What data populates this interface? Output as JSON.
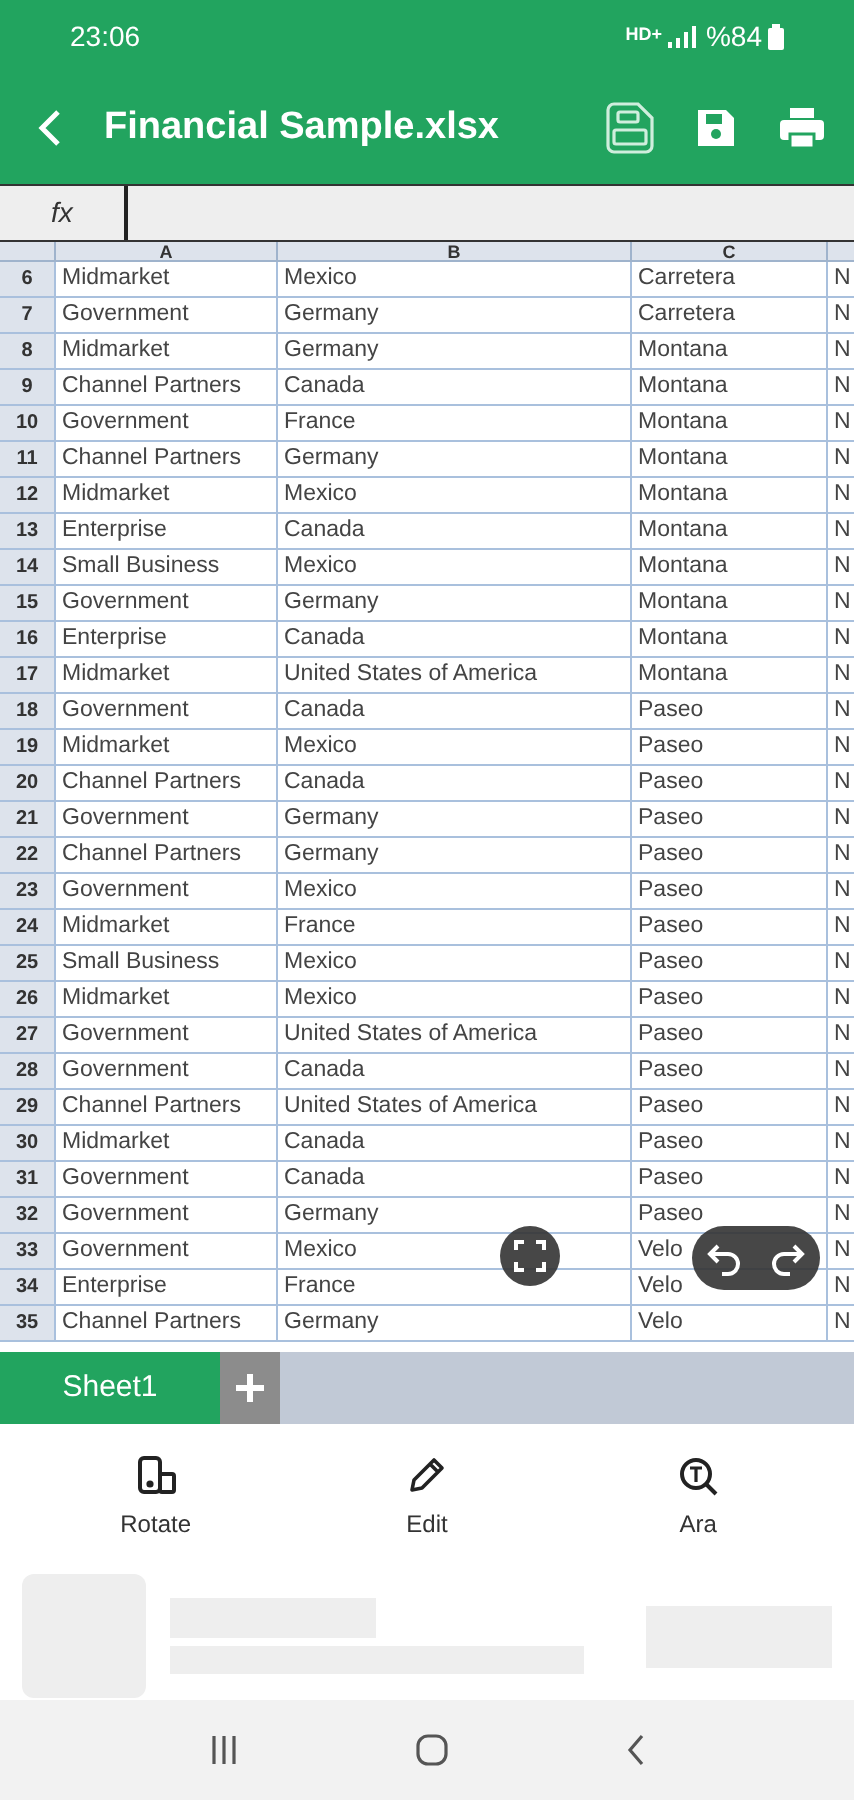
{
  "status_bar": {
    "time": "23:06",
    "network": "HD+",
    "battery": "%84"
  },
  "app_bar": {
    "title": "Financial Sample.xlsx"
  },
  "formula_bar": {
    "label": "fx"
  },
  "sheet": {
    "columns": [
      "A",
      "B",
      "C"
    ],
    "rows": [
      {
        "number": "6",
        "cells": [
          "Midmarket",
          "Mexico",
          "Carretera",
          "N"
        ]
      },
      {
        "number": "7",
        "cells": [
          "Government",
          "Germany",
          "Carretera",
          "N"
        ]
      },
      {
        "number": "8",
        "cells": [
          "Midmarket",
          "Germany",
          "Montana",
          "N"
        ]
      },
      {
        "number": "9",
        "cells": [
          "Channel Partners",
          "Canada",
          "Montana",
          "N"
        ]
      },
      {
        "number": "10",
        "cells": [
          "Government",
          "France",
          "Montana",
          "N"
        ]
      },
      {
        "number": "11",
        "cells": [
          "Channel Partners",
          "Germany",
          "Montana",
          "N"
        ]
      },
      {
        "number": "12",
        "cells": [
          "Midmarket",
          "Mexico",
          "Montana",
          "N"
        ]
      },
      {
        "number": "13",
        "cells": [
          "Enterprise",
          "Canada",
          "Montana",
          "N"
        ]
      },
      {
        "number": "14",
        "cells": [
          "Small Business",
          "Mexico",
          "Montana",
          "N"
        ]
      },
      {
        "number": "15",
        "cells": [
          "Government",
          "Germany",
          "Montana",
          "N"
        ]
      },
      {
        "number": "16",
        "cells": [
          "Enterprise",
          "Canada",
          "Montana",
          "N"
        ]
      },
      {
        "number": "17",
        "cells": [
          "Midmarket",
          "United States of America",
          "Montana",
          "N"
        ]
      },
      {
        "number": "18",
        "cells": [
          "Government",
          "Canada",
          "Paseo",
          "N"
        ]
      },
      {
        "number": "19",
        "cells": [
          "Midmarket",
          "Mexico",
          "Paseo",
          "N"
        ]
      },
      {
        "number": "20",
        "cells": [
          "Channel Partners",
          "Canada",
          "Paseo",
          "N"
        ]
      },
      {
        "number": "21",
        "cells": [
          "Government",
          "Germany",
          "Paseo",
          "N"
        ]
      },
      {
        "number": "22",
        "cells": [
          "Channel Partners",
          "Germany",
          "Paseo",
          "N"
        ]
      },
      {
        "number": "23",
        "cells": [
          "Government",
          "Mexico",
          "Paseo",
          "N"
        ]
      },
      {
        "number": "24",
        "cells": [
          "Midmarket",
          "France",
          "Paseo",
          "N"
        ]
      },
      {
        "number": "25",
        "cells": [
          "Small Business",
          "Mexico",
          "Paseo",
          "N"
        ]
      },
      {
        "number": "26",
        "cells": [
          "Midmarket",
          "Mexico",
          "Paseo",
          "N"
        ]
      },
      {
        "number": "27",
        "cells": [
          "Government",
          "United States of America",
          "Paseo",
          "N"
        ]
      },
      {
        "number": "28",
        "cells": [
          "Government",
          "Canada",
          "Paseo",
          "N"
        ]
      },
      {
        "number": "29",
        "cells": [
          "Channel Partners",
          "United States of America",
          "Paseo",
          "N"
        ]
      },
      {
        "number": "30",
        "cells": [
          "Midmarket",
          "Canada",
          "Paseo",
          "N"
        ]
      },
      {
        "number": "31",
        "cells": [
          "Government",
          "Canada",
          "Paseo",
          "N"
        ]
      },
      {
        "number": "32",
        "cells": [
          "Government",
          "Germany",
          "Paseo",
          "N"
        ]
      },
      {
        "number": "33",
        "cells": [
          "Government",
          "Mexico",
          "Velo",
          "N"
        ]
      },
      {
        "number": "34",
        "cells": [
          "Enterprise",
          "France",
          "Velo",
          "N"
        ]
      },
      {
        "number": "35",
        "cells": [
          "Channel Partners",
          "Germany",
          "Velo",
          "N"
        ]
      }
    ]
  },
  "sheet_tabs": [
    {
      "label": "Sheet1",
      "selected": true
    }
  ],
  "toolbar": [
    {
      "kind": "rotate",
      "label": "Rotate"
    },
    {
      "kind": "edit",
      "label": "Edit"
    },
    {
      "kind": "search",
      "label": "Ara"
    }
  ]
}
